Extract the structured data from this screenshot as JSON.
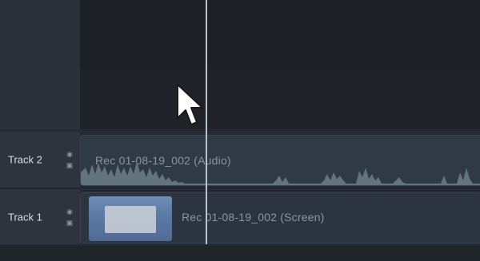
{
  "tracks": [
    {
      "name": "Track 2",
      "clip_label": "Rec 01-08-19_002 (Audio)",
      "type": "audio"
    },
    {
      "name": "Track 1",
      "clip_label": "Rec 01-08-19_002 (Screen)",
      "type": "screen"
    }
  ],
  "icons": {
    "visibility": "eye-icon",
    "lock": "lock-icon",
    "cursor": "mouse-pointer-icon"
  },
  "colors": {
    "playhead": "#b9c3cd",
    "clip_bg": "#2f3a44"
  }
}
